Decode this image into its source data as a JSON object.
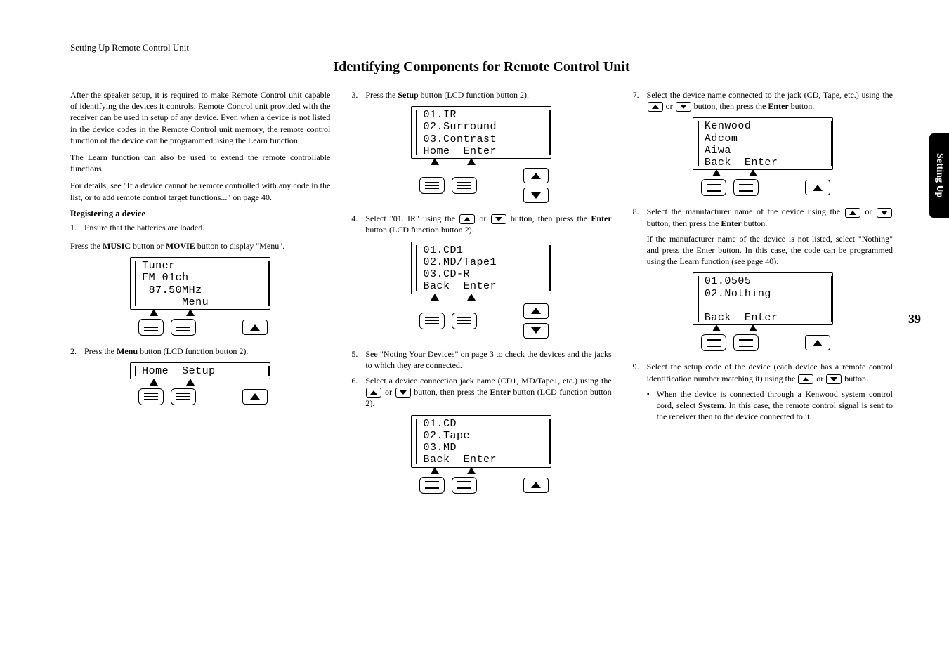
{
  "header_section": "Setting Up Remote Control Unit",
  "main_title": "Identifying Components for Remote Control Unit",
  "side_tab": "Setting Up",
  "page_number": "39",
  "col1": {
    "p1": "After the speaker setup, it is required to make Remote Control unit capable of identifying the devices it controls. Remote Control unit provided with the receiver can be used in setup of any device. Even when a device is not listed in the device codes in the Remote Control unit memory, the remote control function of the device can be programmed using the Learn function.",
    "p2": "The Learn function can also be used to extend the remote controllable functions.",
    "p3": "For details, see \"If a device cannot be remote controlled with any code in the list, or to add remote control target functions...\" on page 40.",
    "subhead": "Registering a device",
    "step1": "Ensure that the batteries are loaded.",
    "press_music_pre": "Press the ",
    "press_music_b1": "MUSIC",
    "press_music_mid": " button or ",
    "press_music_b2": "MOVIE",
    "press_music_post": " button to display \"Menu\".",
    "lcd_tuner": "Tuner\nFM 01ch\n 87.50MHz\n      Menu",
    "step2_pre": "Press the ",
    "step2_b": "Menu",
    "step2_post": " button (LCD function button 2).",
    "lcd_home_setup": "Home  Setup"
  },
  "col2": {
    "step3_pre": "Press the ",
    "step3_b": "Setup",
    "step3_post": " button (LCD function button 2).",
    "lcd_ir": "01.IR\n02.Surround\n03.Contrast\nHome  Enter",
    "step4_pre": "Select \"01. IR\" using the ",
    "step4_mid": " or ",
    "step4_post1": " button, then press the ",
    "step4_b": "Enter",
    "step4_post2": " button (LCD function button 2).",
    "lcd_cd1": "01.CD1\n02.MD/Tape1\n03.CD-R\nBack  Enter",
    "step5": "See \"Noting Your Devices\" on page 3 to check the devices and the jacks to which they are connected.",
    "step6_pre": "Select a device connection jack name (CD1, MD/Tape1, etc.) using the ",
    "step6_mid": " or ",
    "step6_post1": " button, then press the ",
    "step6_b": "Enter",
    "step6_post2": " button (LCD function button 2).",
    "lcd_cd": "01.CD\n02.Tape\n03.MD\nBack  Enter"
  },
  "col3": {
    "step7_pre": "Select the device name connected to the jack (CD, Tape, etc.) using the ",
    "step7_mid": " or ",
    "step7_post1": " button, then press the ",
    "step7_b": "Enter",
    "step7_post2": " button.",
    "lcd_kenwood": "Kenwood\nAdcom\nAiwa\nBack  Enter",
    "step8_pre": "Select the manufacturer name of the device using the ",
    "step8_mid": " or ",
    "step8_post1": " button, then press the ",
    "step8_b": "Enter",
    "step8_post2": " button.",
    "step8_note": "If the manufacturer name of the device is not listed, select \"Nothing\" and press the Enter button. In this case, the code can be programmed using the Learn function (see page 40).",
    "lcd_nothing": "01.0505\n02.Nothing\n\nBack  Enter",
    "step9_pre": "Select the setup code of the device (each device has a remote control identification number matching it) using the ",
    "step9_mid": " or ",
    "step9_post": " button.",
    "bullet_pre": "When the device is connected through a Kenwood system control cord, select ",
    "bullet_b": "System",
    "bullet_post": ". In this case, the remote control signal is sent to the receiver then to the device connected to it."
  }
}
